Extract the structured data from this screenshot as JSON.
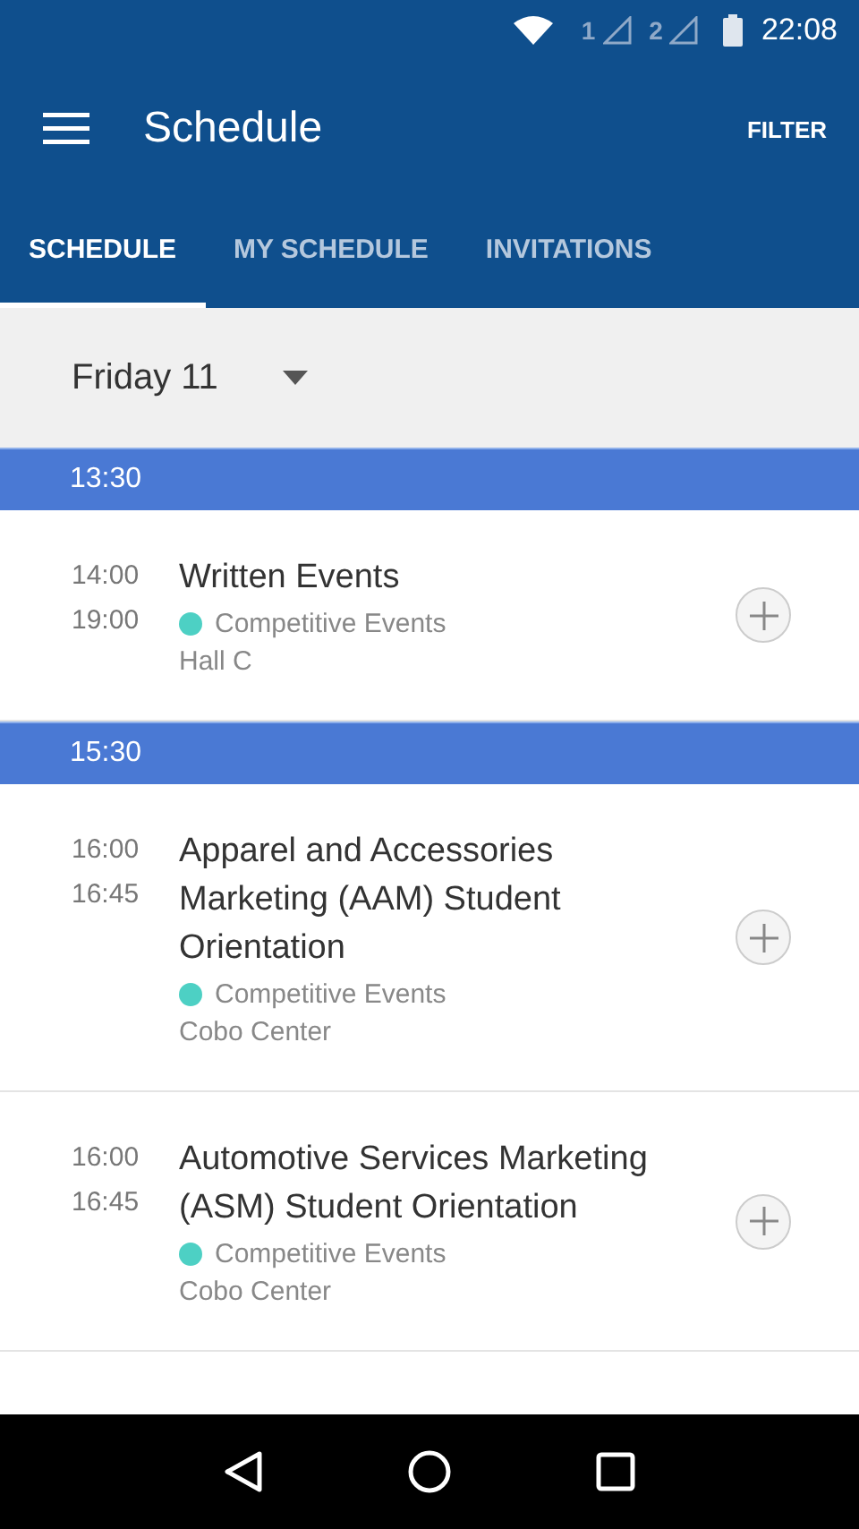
{
  "status_bar": {
    "sims": [
      "1",
      "2"
    ],
    "time": "22:08"
  },
  "app_bar": {
    "title": "Schedule",
    "action": "FILTER"
  },
  "tabs": [
    {
      "label": "SCHEDULE",
      "selected": true
    },
    {
      "label": "MY SCHEDULE",
      "selected": false
    },
    {
      "label": "INVITATIONS",
      "selected": false
    }
  ],
  "day_selector": {
    "value": "Friday 11"
  },
  "sections": [
    {
      "time": "13:30",
      "events": [
        {
          "start": "14:00",
          "end": "19:00",
          "title": "Written Events",
          "category": "Competitive Events",
          "color": "#4dd0c4",
          "location": "Hall C"
        }
      ]
    },
    {
      "time": "15:30",
      "events": [
        {
          "start": "16:00",
          "end": "16:45",
          "title": "Apparel and Accessories Marketing (AAM) Student Orientation",
          "category": "Competitive Events",
          "color": "#4dd0c4",
          "location": "Cobo Center"
        },
        {
          "start": "16:00",
          "end": "16:45",
          "title": "Automotive Services Marketing (ASM) Student Orientation",
          "category": "Competitive Events",
          "color": "#4dd0c4",
          "location": "Cobo Center"
        }
      ]
    }
  ]
}
